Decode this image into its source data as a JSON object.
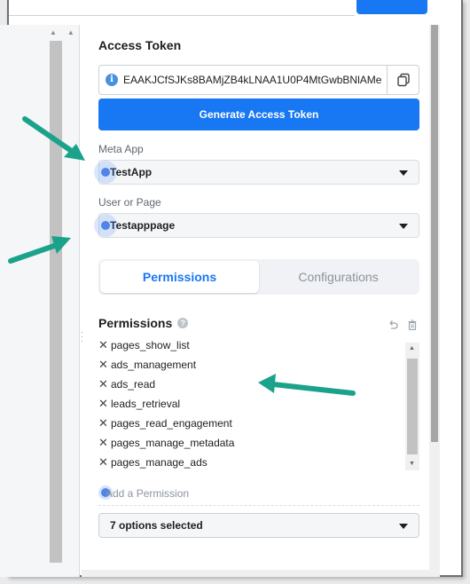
{
  "access_token": {
    "section_title": "Access Token",
    "token_value": "EAAKJCfSJKs8BAMjZB4kLNAA1U0P4MtGwbBNlAMe",
    "generate_label": "Generate Access Token"
  },
  "meta_app": {
    "label": "Meta App",
    "selected": "TestApp"
  },
  "user_or_page": {
    "label": "User or Page",
    "selected": "Testapppage"
  },
  "tabs": [
    {
      "label": "Permissions",
      "active": true
    },
    {
      "label": "Configurations",
      "active": false
    }
  ],
  "permissions": {
    "title": "Permissions",
    "items": [
      "pages_show_list",
      "ads_management",
      "ads_read",
      "leads_retrieval",
      "pages_read_engagement",
      "pages_manage_metadata",
      "pages_manage_ads"
    ],
    "add_placeholder": "Add a Permission",
    "options_selected": "7 options selected"
  },
  "colors": {
    "accent": "#1877f2",
    "annotation_arrow": "#1aa38a"
  },
  "icons": {
    "info": "info-icon",
    "copy": "copy-icon",
    "help": "help-icon",
    "undo": "undo-icon",
    "trash": "trash-icon",
    "caret": "caret-down-icon",
    "remove": "x-icon"
  }
}
